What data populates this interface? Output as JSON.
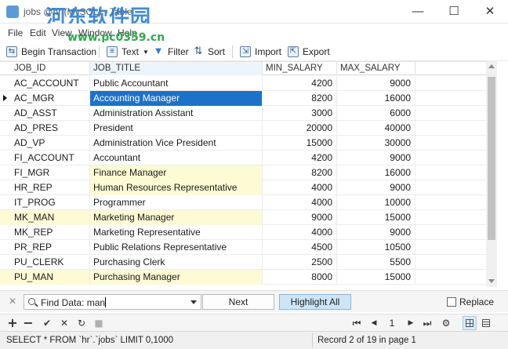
{
  "window": {
    "title": "jobs @hr (MySQL) - Table",
    "watermark": "河东软件园",
    "watermark_url": "www.pc0359.cn",
    "minimize": "—",
    "maximize": "☐",
    "close": "✕"
  },
  "menu": {
    "items": [
      "File",
      "Edit",
      "View",
      "Window",
      "Help"
    ]
  },
  "toolbar": {
    "begin_transaction": "Begin Transaction",
    "text": "Text",
    "filter": "Filter",
    "sort": "Sort",
    "import": "Import",
    "export": "Export"
  },
  "grid": {
    "columns": [
      "JOB_ID",
      "JOB_TITLE",
      "MIN_SALARY",
      "MAX_SALARY"
    ],
    "rows": [
      {
        "job_id": "AC_ACCOUNT",
        "job_title": "Public Accountant",
        "min": "4200",
        "max": "9000"
      },
      {
        "job_id": "AC_MGR",
        "job_title": "Accounting Manager",
        "min": "8200",
        "max": "16000"
      },
      {
        "job_id": "AD_ASST",
        "job_title": "Administration Assistant",
        "min": "3000",
        "max": "6000"
      },
      {
        "job_id": "AD_PRES",
        "job_title": "President",
        "min": "20000",
        "max": "40000"
      },
      {
        "job_id": "AD_VP",
        "job_title": "Administration Vice President",
        "min": "15000",
        "max": "30000"
      },
      {
        "job_id": "FI_ACCOUNT",
        "job_title": "Accountant",
        "min": "4200",
        "max": "9000"
      },
      {
        "job_id": "FI_MGR",
        "job_title": "Finance Manager",
        "min": "8200",
        "max": "16000"
      },
      {
        "job_id": "HR_REP",
        "job_title": "Human Resources Representative",
        "min": "4000",
        "max": "9000"
      },
      {
        "job_id": "IT_PROG",
        "job_title": "Programmer",
        "min": "4000",
        "max": "10000"
      },
      {
        "job_id": "MK_MAN",
        "job_title": "Marketing Manager",
        "min": "9000",
        "max": "15000"
      },
      {
        "job_id": "MK_REP",
        "job_title": "Marketing Representative",
        "min": "4000",
        "max": "9000"
      },
      {
        "job_id": "PR_REP",
        "job_title": "Public Relations Representative",
        "min": "4500",
        "max": "10500"
      },
      {
        "job_id": "PU_CLERK",
        "job_title": "Purchasing Clerk",
        "min": "2500",
        "max": "5500"
      },
      {
        "job_id": "PU_MAN",
        "job_title": "Purchasing Manager",
        "min": "8000",
        "max": "15000"
      }
    ]
  },
  "find": {
    "label": "Find Data: ",
    "value": "man",
    "next": "Next",
    "highlight_all": "Highlight All",
    "replace": "Replace"
  },
  "nav": {
    "add": "+",
    "delete": "−",
    "apply": "✔",
    "discard": "✕",
    "refresh": "↻",
    "stop": "■",
    "first": "⏮",
    "prev": "◀",
    "page": "1",
    "next": "▶",
    "last": "⏭",
    "settings": "⚙"
  },
  "status": {
    "sql": "SELECT * FROM `hr`.`jobs` LIMIT 0,1000",
    "record": "Record 2 of 19 in page 1"
  },
  "colors": {
    "selection": "#1c72c9",
    "highlight": "#fdfbd4",
    "highlight_all_button": "#cde5f7"
  }
}
